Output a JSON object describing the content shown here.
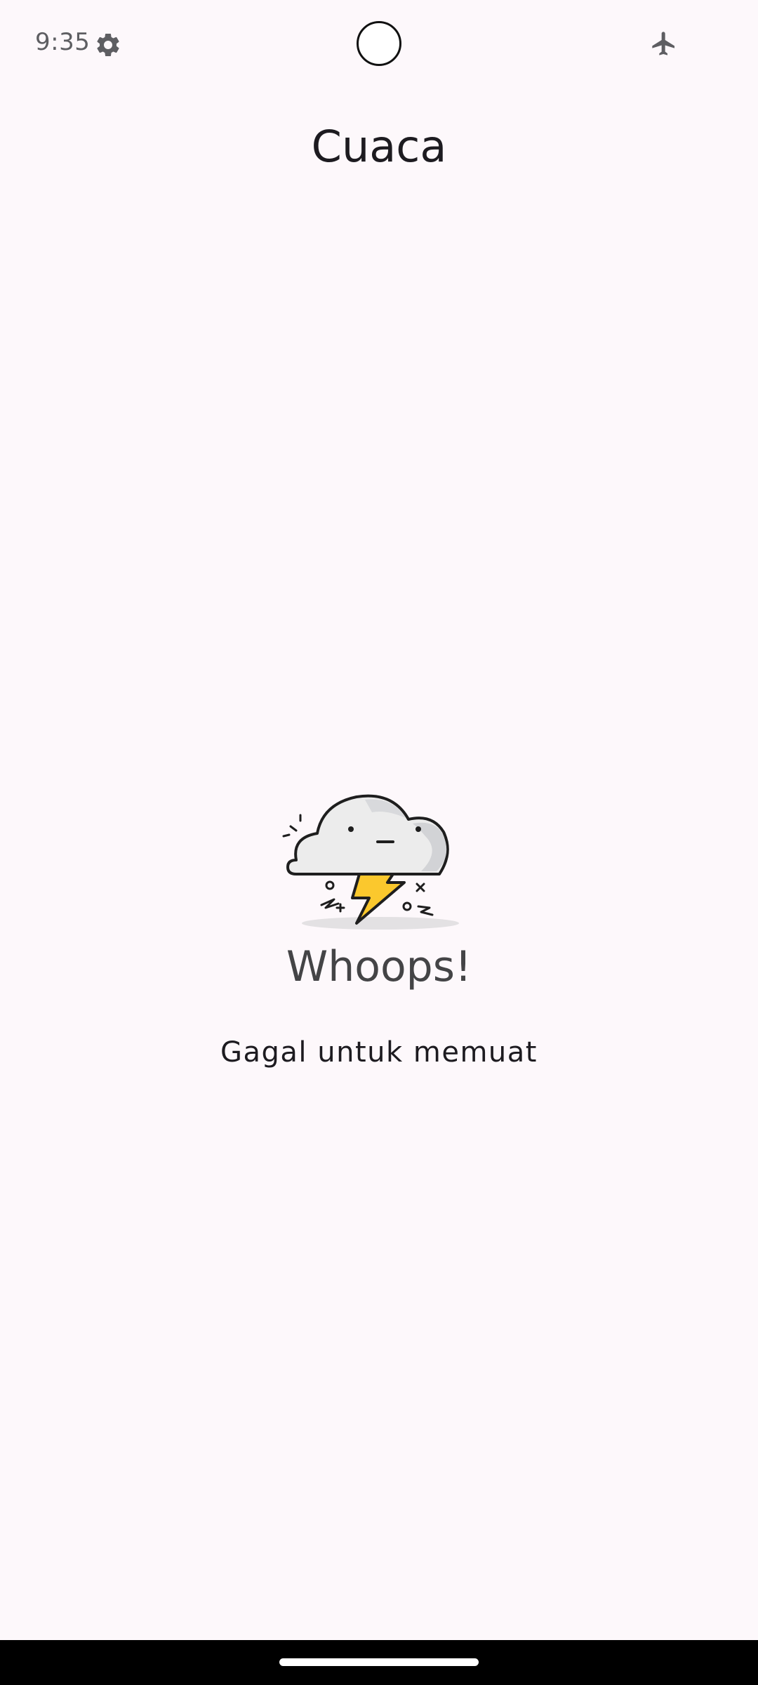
{
  "status_bar": {
    "time": "9:35",
    "left_icon": "settings-gear-icon",
    "right_icon": "airplane-mode-icon"
  },
  "app": {
    "title": "Cuaca"
  },
  "error_state": {
    "illustration": "storm-cloud-lightning-icon",
    "heading": "Whoops!",
    "message": "Gagal untuk memuat"
  },
  "colors": {
    "background": "#fdf8fb",
    "lightning": "#fbc82d",
    "cloud": "#ececec",
    "nav_bar": "#000000"
  }
}
